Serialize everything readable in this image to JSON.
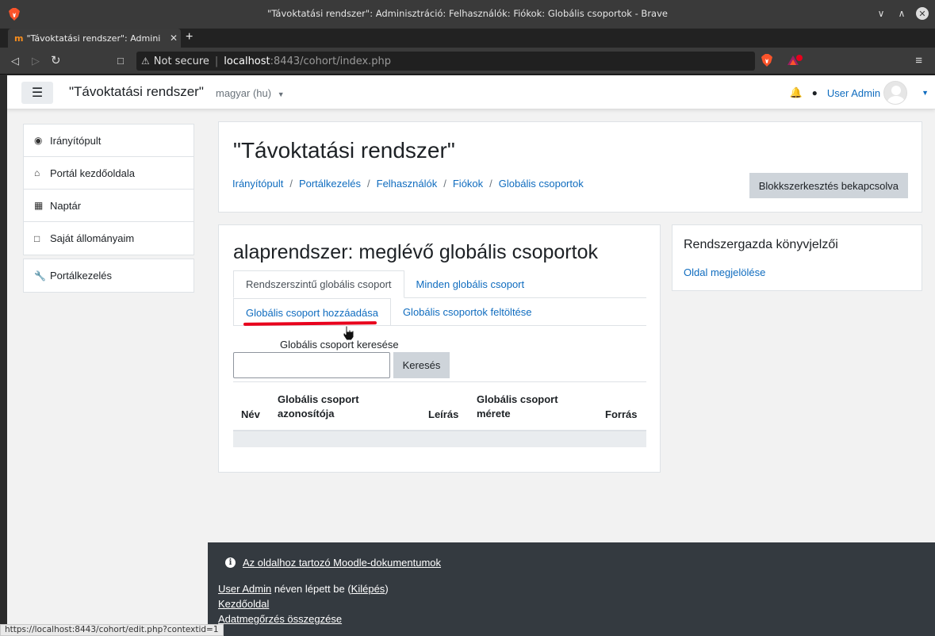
{
  "window": {
    "title": "\"Távoktatási rendszer\": Adminisztráció: Felhasználók: Fiókok: Globális csoportok - Brave"
  },
  "browser": {
    "tab_title": "\"Távoktatási rendszer\": Admini",
    "tab_favicon": "m",
    "url_warning": "Not secure",
    "url_host": "localhost",
    "url_path": ":8443/cohort/index.php",
    "status_url": "https://localhost:8443/cohort/edit.php?contextid=1"
  },
  "navbar": {
    "brand": "\"Távoktatási rendszer\"",
    "language": "magyar (hu)",
    "user_name": "User Admin"
  },
  "drawer": {
    "items": [
      {
        "label": "Irányítópult",
        "icon": "dashboard-icon"
      },
      {
        "label": "Portál kezdőoldala",
        "icon": "home-icon"
      },
      {
        "label": "Naptár",
        "icon": "calendar-icon"
      },
      {
        "label": "Saját állományaim",
        "icon": "file-icon"
      }
    ],
    "admin_item": {
      "label": "Portálkezelés",
      "icon": "wrench-icon"
    }
  },
  "header": {
    "title": "\"Távoktatási rendszer\"",
    "breadcrumb": [
      "Irányítópult",
      "Portálkezelés",
      "Felhasználók",
      "Fiókok",
      "Globális csoportok"
    ],
    "edit_button": "Blokkszerkesztés bekapcsolva"
  },
  "main": {
    "title": "alaprendszer: meglévő globális csoportok",
    "tabs_row1": [
      "Rendszerszintű globális csoport",
      "Minden globális csoport"
    ],
    "tabs_row2": [
      "Globális csoport hozzáadása",
      "Globális csoportok feltöltése"
    ],
    "search_label": "Globális csoport keresése",
    "search_button": "Keresés",
    "search_value": "",
    "table_headers": {
      "name": "Név",
      "id_line1": "Globális csoport",
      "id_line2": "azonosítója",
      "desc": "Leírás",
      "size_line1": "Globális csoport",
      "size_line2": "mérete",
      "source": "Forrás"
    }
  },
  "block": {
    "title": "Rendszergazda könyvjelzői",
    "link": "Oldal megjelölése"
  },
  "footer": {
    "docs_link": "Az oldalhoz tartozó Moodle-dokumentumok",
    "login_user": "User Admin",
    "login_text": " néven lépett be (",
    "logout": "Kilépés",
    "login_end": ")",
    "home_link": "Kezdőoldal",
    "retention_link": "Adatmegőrzés összegzése"
  },
  "colors": {
    "link": "#0f6cbf",
    "footer_bg": "#343a40",
    "annotation_red": "#e8001c"
  }
}
